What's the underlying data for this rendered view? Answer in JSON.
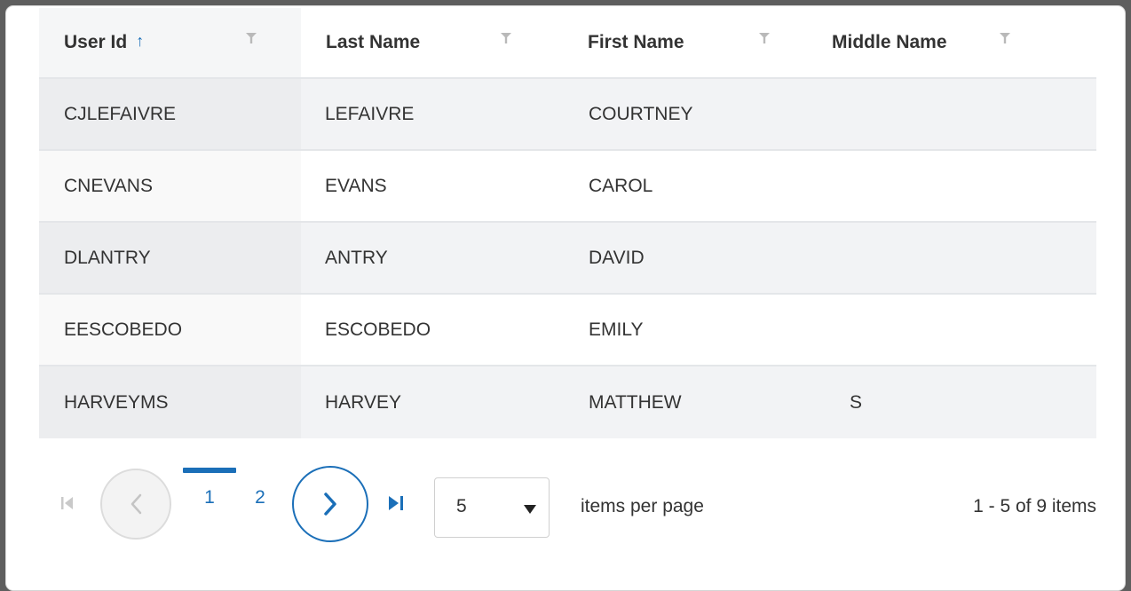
{
  "grid": {
    "columns": [
      {
        "label": "User Id",
        "sort_icon": "arrow-up-icon",
        "filter_icon": "filter-icon"
      },
      {
        "label": "Last Name",
        "filter_icon": "filter-icon"
      },
      {
        "label": "First Name",
        "filter_icon": "filter-icon"
      },
      {
        "label": "Middle Name",
        "filter_icon": "filter-icon"
      }
    ],
    "sort_glyph": "↑",
    "rows": [
      {
        "user_id": "CJLEFAIVRE",
        "last_name": "LEFAIVRE",
        "first_name": "COURTNEY",
        "middle_name": ""
      },
      {
        "user_id": "CNEVANS",
        "last_name": "EVANS",
        "first_name": "CAROL",
        "middle_name": ""
      },
      {
        "user_id": "DLANTRY",
        "last_name": "ANTRY",
        "first_name": "DAVID",
        "middle_name": ""
      },
      {
        "user_id": "EESCOBEDO",
        "last_name": "ESCOBEDO",
        "first_name": "EMILY",
        "middle_name": ""
      },
      {
        "user_id": "HARVEYMS",
        "last_name": "HARVEY",
        "first_name": "MATTHEW",
        "middle_name": "S"
      }
    ]
  },
  "pager": {
    "pages": [
      "1",
      "2"
    ],
    "current_page": "1",
    "page_size": "5",
    "items_per_page_label": "items per page",
    "info": "1 - 5 of 9 items",
    "icons": {
      "first": "first-page-icon",
      "prev": "chevron-left-icon",
      "next": "chevron-right-icon",
      "last": "last-page-icon",
      "dropdown": "caret-down-icon"
    }
  },
  "colors": {
    "accent": "#1b6fb8",
    "row_alt": "#f2f3f5",
    "border": "#e4e6e9",
    "text": "#333333"
  }
}
